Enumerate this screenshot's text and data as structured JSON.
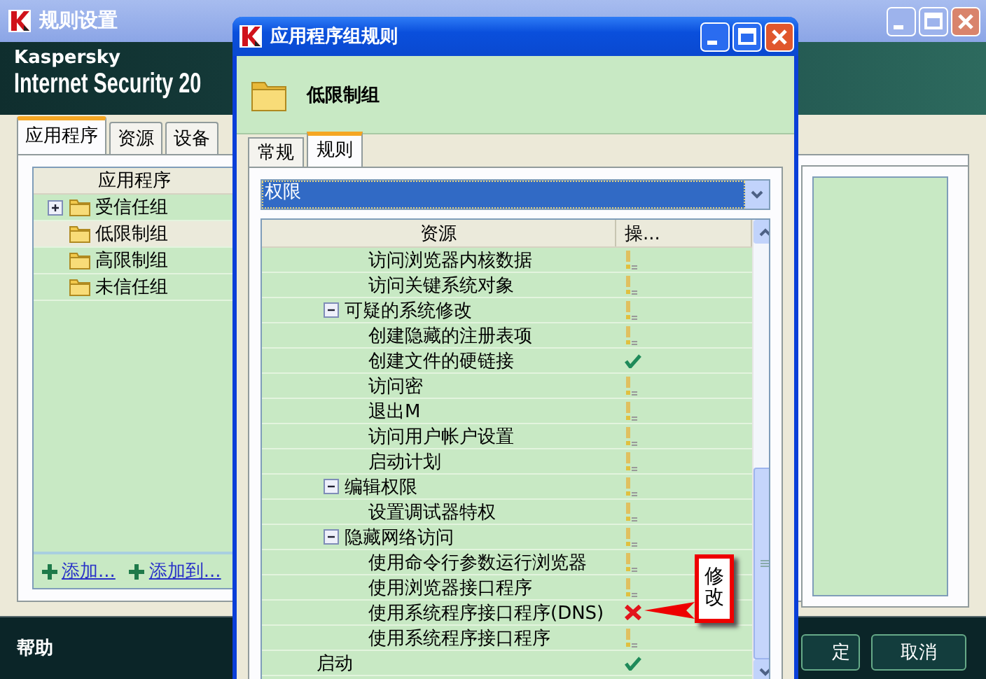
{
  "main_window": {
    "title": "规则设置",
    "brand": "Kaspersky",
    "product": "Internet Security 20",
    "tabs": [
      {
        "label": "应用程序",
        "selected": true
      },
      {
        "label": "资源",
        "selected": false
      },
      {
        "label": "设备",
        "selected": false
      }
    ],
    "list": {
      "column": "应用程序",
      "items": [
        {
          "label": "受信任组",
          "has_children": true,
          "selected": false
        },
        {
          "label": "低限制组",
          "has_children": false,
          "selected": true
        },
        {
          "label": "高限制组",
          "has_children": false,
          "selected": false
        },
        {
          "label": "未信任组",
          "has_children": false,
          "selected": false
        }
      ]
    },
    "links": [
      "添加...",
      "添加到..."
    ],
    "help": "帮助",
    "buttons": [
      "定",
      "取消"
    ]
  },
  "dialog": {
    "title": "应用程序组规则",
    "group_name": "低限制组",
    "tabs": [
      {
        "label": "常规",
        "selected": false
      },
      {
        "label": "规则",
        "selected": true
      }
    ],
    "dropdown": {
      "value": "权限"
    },
    "table": {
      "columns": [
        "资源",
        "操..."
      ],
      "rows": [
        {
          "children": [
            {
              "children": [
                {
                  "label": "访问浏览器内核数据",
                  "kind": "prompt"
                },
                {
                  "label": "访问关键系统对象",
                  "kind": "prompt"
                }
              ]
            },
            {
              "label": "可疑的系统修改",
              "kind": "prompt",
              "expanded": true,
              "children": [
                {
                  "label": "创建隐藏的注册表项",
                  "kind": "prompt"
                },
                {
                  "label": "创建文件的硬链接",
                  "kind": "allow"
                },
                {
                  "label": "访问密",
                  "kind": "prompt"
                },
                {
                  "label": "退出M",
                  "kind": "prompt"
                },
                {
                  "label": "访问用户帐户设置",
                  "kind": "prompt"
                },
                {
                  "label": "启动计划",
                  "kind": "prompt"
                }
              ]
            },
            {
              "label": "编辑权限",
              "kind": "prompt",
              "expanded": true,
              "children": [
                {
                  "label": "设置调试器特权",
                  "kind": "prompt"
                }
              ]
            },
            {
              "label": "隐藏网络访问",
              "kind": "prompt",
              "expanded": true,
              "children": [
                {
                  "label": "使用命令行参数运行浏览器",
                  "kind": "prompt"
                },
                {
                  "label": "使用浏览器接口程序",
                  "kind": "prompt"
                },
                {
                  "label": "使用系统程序接口程序(DNS)",
                  "kind": "deny"
                },
                {
                  "label": "使用系统程序接口程序",
                  "kind": "prompt"
                }
              ]
            }
          ]
        },
        {
          "label": "启动",
          "kind": "allow"
        }
      ]
    }
  },
  "annotation": {
    "text": "修改"
  }
}
